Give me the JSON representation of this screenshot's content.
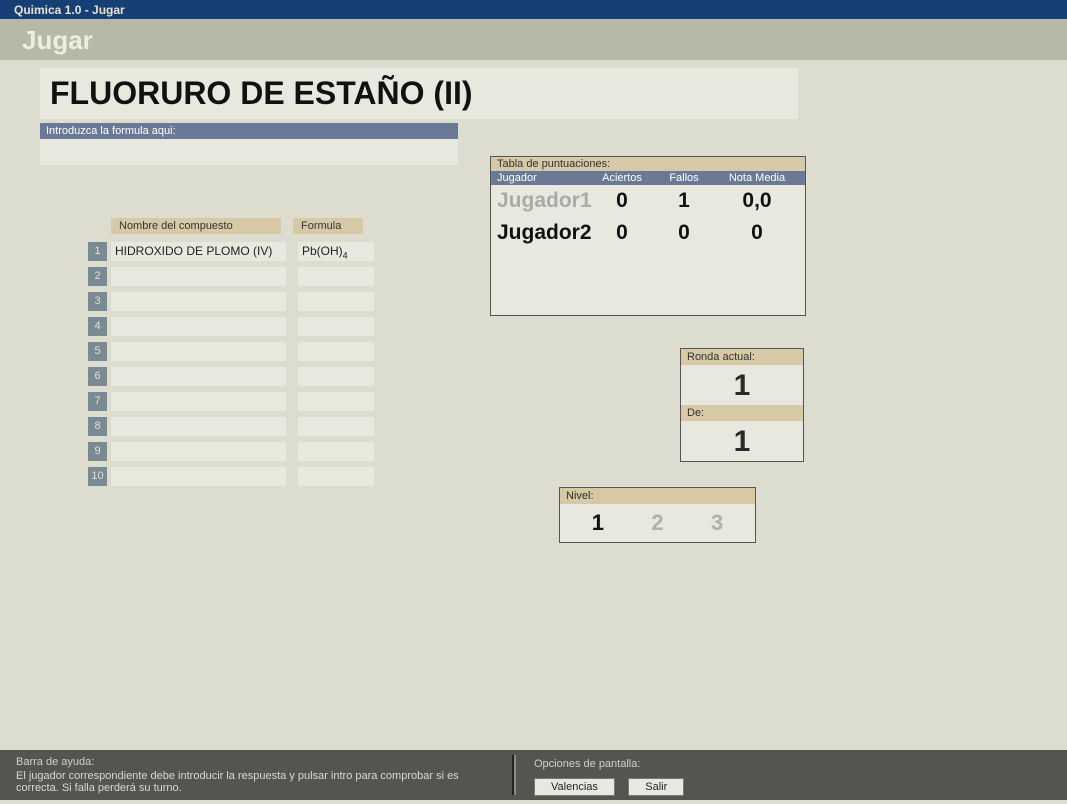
{
  "window_title": "Quimica 1.0 - Jugar",
  "header": {
    "title": "Jugar"
  },
  "compound": "FLUORURO DE ESTAÑO (II)",
  "input": {
    "label": "Introduzca la formula aqui:",
    "value": ""
  },
  "list": {
    "headers": {
      "name": "Nombre del compuesto",
      "formula": "Formula"
    },
    "rows": [
      {
        "n": "1",
        "name": "HIDROXIDO DE PLOMO (IV)",
        "formula": "Pb(OH)",
        "sub": "4"
      },
      {
        "n": "2",
        "name": "",
        "formula": "",
        "sub": ""
      },
      {
        "n": "3",
        "name": "",
        "formula": "",
        "sub": ""
      },
      {
        "n": "4",
        "name": "",
        "formula": "",
        "sub": ""
      },
      {
        "n": "5",
        "name": "",
        "formula": "",
        "sub": ""
      },
      {
        "n": "6",
        "name": "",
        "formula": "",
        "sub": ""
      },
      {
        "n": "7",
        "name": "",
        "formula": "",
        "sub": ""
      },
      {
        "n": "8",
        "name": "",
        "formula": "",
        "sub": ""
      },
      {
        "n": "9",
        "name": "",
        "formula": "",
        "sub": ""
      },
      {
        "n": "10",
        "name": "",
        "formula": "",
        "sub": ""
      }
    ]
  },
  "scores": {
    "title": "Tabla de puntuaciones:",
    "cols": {
      "player": "Jugador",
      "hits": "Aciertos",
      "miss": "Fallos",
      "avg": "Nota Media"
    },
    "rows": [
      {
        "name": "Jugador1",
        "hits": "0",
        "miss": "1",
        "avg": "0,0",
        "active": false
      },
      {
        "name": "Jugador2",
        "hits": "0",
        "miss": "0",
        "avg": "0",
        "active": true
      }
    ]
  },
  "round": {
    "current_label": "Ronda actual:",
    "current": "1",
    "total_label": "De:",
    "total": "1"
  },
  "level": {
    "title": "Nivel:",
    "values": [
      "1",
      "2",
      "3"
    ],
    "active": 0
  },
  "footer": {
    "help_title": "Barra de ayuda:",
    "help_text": "El jugador correspondiente debe introducir la respuesta y pulsar intro para comprobar si es correcta. Si falla perderá su turno.",
    "options_title": "Opciones de pantalla:",
    "btn_valencias": "Valencias",
    "btn_salir": "Salir"
  }
}
